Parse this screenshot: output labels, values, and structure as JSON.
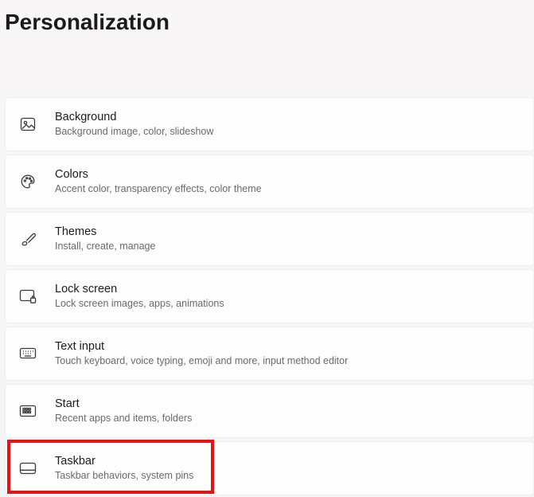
{
  "page": {
    "title": "Personalization"
  },
  "items": [
    {
      "title": "Background",
      "desc": "Background image, color, slideshow"
    },
    {
      "title": "Colors",
      "desc": "Accent color, transparency effects, color theme"
    },
    {
      "title": "Themes",
      "desc": "Install, create, manage"
    },
    {
      "title": "Lock screen",
      "desc": "Lock screen images, apps, animations"
    },
    {
      "title": "Text input",
      "desc": "Touch keyboard, voice typing, emoji and more, input method editor"
    },
    {
      "title": "Start",
      "desc": "Recent apps and items, folders"
    },
    {
      "title": "Taskbar",
      "desc": "Taskbar behaviors, system pins"
    }
  ]
}
